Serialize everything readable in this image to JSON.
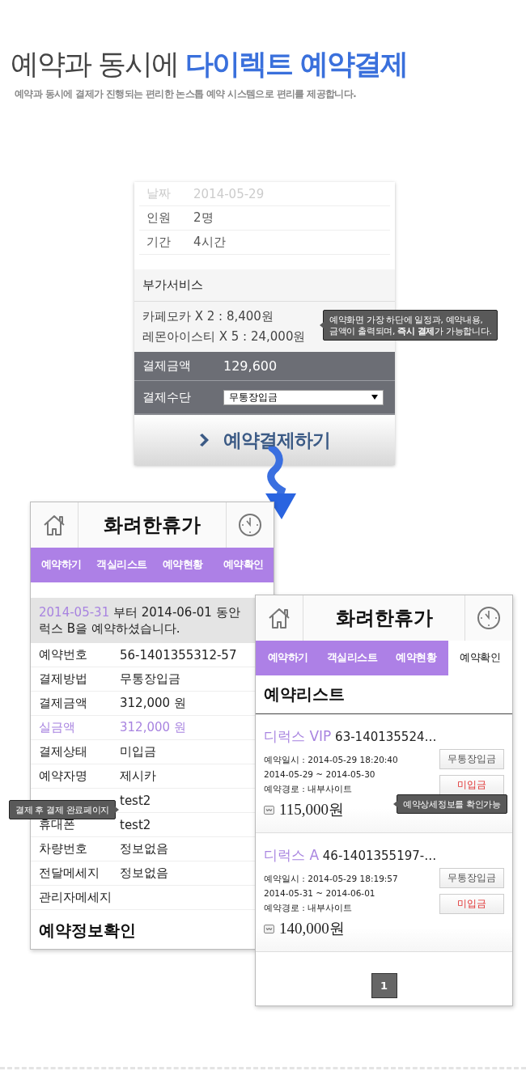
{
  "headline": {
    "plain": "예약과 동시에",
    "accent": "다이렉트 예약결제"
  },
  "subtitle": "예약과 동시에 결제가 진행되는 편리한 논스톱 예약 시스템으로 편리를 제공합니다.",
  "order_form": {
    "details": [
      {
        "label": "날짜",
        "value": "2014-05-29",
        "faded": true
      },
      {
        "label": "인원",
        "value": "2명",
        "faded": false
      },
      {
        "label": "기간",
        "value": "4시간",
        "faded": false
      }
    ],
    "extras_title": "부가서비스",
    "extras": [
      "카페모카 X 2 : 8,400원",
      "레몬아이스티 X 5 : 24,000원"
    ],
    "total_label": "결제금액",
    "total": "129,600",
    "method_label": "결제수단",
    "method": "무통장입금",
    "submit": "예약결제하기"
  },
  "completion_screen": {
    "title": "화려한휴가",
    "tabs": [
      {
        "label": "예약하기",
        "selected": false
      },
      {
        "label": "객실리스트",
        "selected": false
      },
      {
        "label": "예약현황",
        "selected": false
      },
      {
        "label": "예약확인",
        "selected": false
      }
    ],
    "message_date": "2014-05-31",
    "message_text": "부터 2014-06-01 동안",
    "message_line2": "럭스 B을 예약하셨습니다.",
    "rows": [
      {
        "label": "예약번호",
        "value": "56-1401355312-57",
        "highlighted": false
      },
      {
        "label": "결제방법",
        "value": "무통장입금",
        "highlighted": false
      },
      {
        "label": "결제금액",
        "value": "312,000 원",
        "highlighted": false
      },
      {
        "label": "실금액",
        "value": "312,000 원",
        "highlighted": true
      },
      {
        "label": "결제상태",
        "value": "미입금",
        "highlighted": false
      },
      {
        "label": "예약자명",
        "value": "제시카",
        "highlighted": false
      },
      {
        "value": "test2",
        "highlighted": false
      },
      {
        "label": "휴대폰",
        "value": "test2",
        "highlighted": false
      },
      {
        "label": "차량번호",
        "value": "정보없음",
        "highlighted": false
      },
      {
        "label": "전달메세지",
        "value": "정보없음",
        "highlighted": false
      },
      {
        "label": "관리자메세지",
        "value": "",
        "highlighted": false
      }
    ],
    "section_title": "예약정보확인"
  },
  "list_screen": {
    "title": "화려한휴가",
    "tabs": [
      {
        "label": "예약하기",
        "selected": false
      },
      {
        "label": "객실리스트",
        "selected": false
      },
      {
        "label": "예약현황",
        "selected": false
      },
      {
        "label": "예약확인",
        "selected": true
      }
    ],
    "list_title": "예약리스트",
    "reservations": [
      {
        "room": "디럭스 VIP",
        "number": "63-140135524…",
        "booked_at": "예약일시 : 2014-05-29 18:20:40",
        "period": "2014-05-29 ~ 2014-05-30",
        "route": "예약경로 : 내부사이트",
        "price": "115,000원",
        "method": "무통장입금",
        "status": "미입금"
      },
      {
        "room": "디럭스 A",
        "number": "46-1401355197-…",
        "booked_at": "예약일시 : 2014-05-29 18:19:57",
        "period": "2014-05-31 ~ 2014-06-01",
        "route": "예약경로 : 내부사이트",
        "price": "140,000원",
        "method": "무통장입금",
        "status": "미입금"
      }
    ],
    "pages": [
      {
        "label": "1",
        "selected": true
      }
    ]
  },
  "tooltips": [
    {
      "lines": [
        "예약화면 가장 하단에 일정과, 예약내용,",
        "금액이 출력되며, **즉시 결제**가 가능합니다."
      ],
      "kind": "left"
    },
    {
      "lines": [
        "결제 후 결제 완료페이지"
      ],
      "kind": "right"
    },
    {
      "lines": [
        "예약상세정보를 확인가능"
      ],
      "kind": "left"
    }
  ]
}
